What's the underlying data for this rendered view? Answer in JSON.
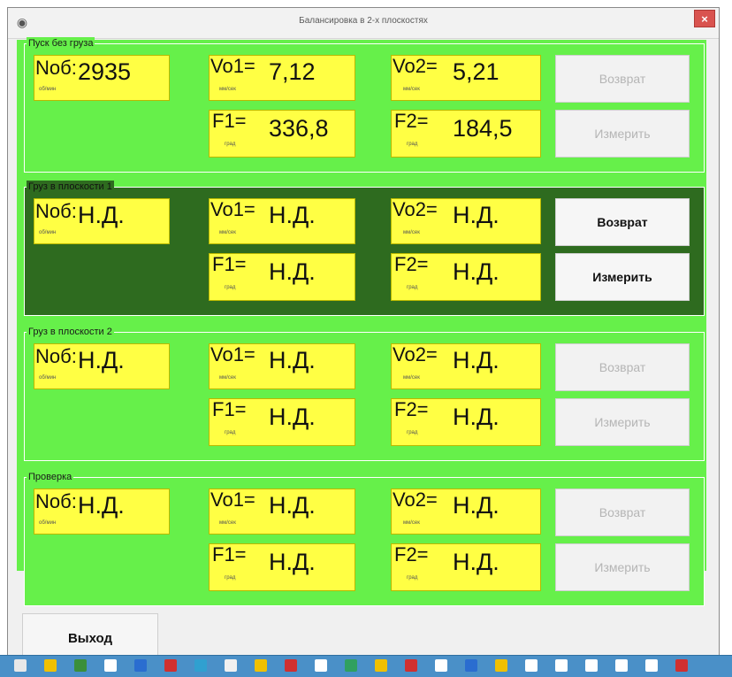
{
  "window": {
    "title": "Балансировка в 2-х плоскостях",
    "close_glyph": "×",
    "app_icon": "app-icon"
  },
  "groups": [
    {
      "title": "Пуск без груза",
      "active": false,
      "nob": {
        "label": "Nоб:",
        "unit": "об/мин",
        "value": "2935"
      },
      "vo1": {
        "label": "Vo1=",
        "unit": "мм/сек",
        "value": "7,12"
      },
      "vo2": {
        "label": "Vo2=",
        "unit": "мм/сек",
        "value": "5,21"
      },
      "f1": {
        "label": "F1=",
        "unit": "град",
        "value": "336,8"
      },
      "f2": {
        "label": "F2=",
        "unit": "град",
        "value": "184,5"
      },
      "return_label": "Возврат",
      "measure_label": "Измерить",
      "buttons_enabled": false
    },
    {
      "title": "Груз в плоскости 1",
      "active": true,
      "nob": {
        "label": "Nоб:",
        "unit": "об/мин",
        "value": "Н.Д."
      },
      "vo1": {
        "label": "Vo1=",
        "unit": "мм/сек",
        "value": "Н.Д."
      },
      "vo2": {
        "label": "Vo2=",
        "unit": "мм/сек",
        "value": "Н.Д."
      },
      "f1": {
        "label": "F1=",
        "unit": "град",
        "value": "Н.Д."
      },
      "f2": {
        "label": "F2=",
        "unit": "град",
        "value": "Н.Д."
      },
      "return_label": "Возврат",
      "measure_label": "Измерить",
      "buttons_enabled": true
    },
    {
      "title": "Груз в плоскости 2",
      "active": false,
      "nob": {
        "label": "Nоб:",
        "unit": "об/мин",
        "value": "Н.Д."
      },
      "vo1": {
        "label": "Vo1=",
        "unit": "мм/сек",
        "value": "Н.Д."
      },
      "vo2": {
        "label": "Vo2=",
        "unit": "мм/сек",
        "value": "Н.Д."
      },
      "f1": {
        "label": "F1=",
        "unit": "град",
        "value": "Н.Д."
      },
      "f2": {
        "label": "F2=",
        "unit": "град",
        "value": "Н.Д."
      },
      "return_label": "Возврат",
      "measure_label": "Измерить",
      "buttons_enabled": false
    },
    {
      "title": "Проверка",
      "active": false,
      "nob": {
        "label": "Nоб:",
        "unit": "об/мин",
        "value": "Н.Д."
      },
      "vo1": {
        "label": "Vo1=",
        "unit": "мм/сек",
        "value": "Н.Д."
      },
      "vo2": {
        "label": "Vo2=",
        "unit": "мм/сек",
        "value": "Н.Д."
      },
      "f1": {
        "label": "F1=",
        "unit": "град",
        "value": "Н.Д."
      },
      "f2": {
        "label": "F2=",
        "unit": "град",
        "value": "Н.Д."
      },
      "return_label": "Возврат",
      "measure_label": "Измерить",
      "buttons_enabled": false
    }
  ],
  "exit_label": "Выход",
  "colors": {
    "panel_green": "#66f04a",
    "active_green": "#2e6b1f",
    "value_yellow": "#ffff44",
    "taskbar_blue": "#4a90c8"
  }
}
